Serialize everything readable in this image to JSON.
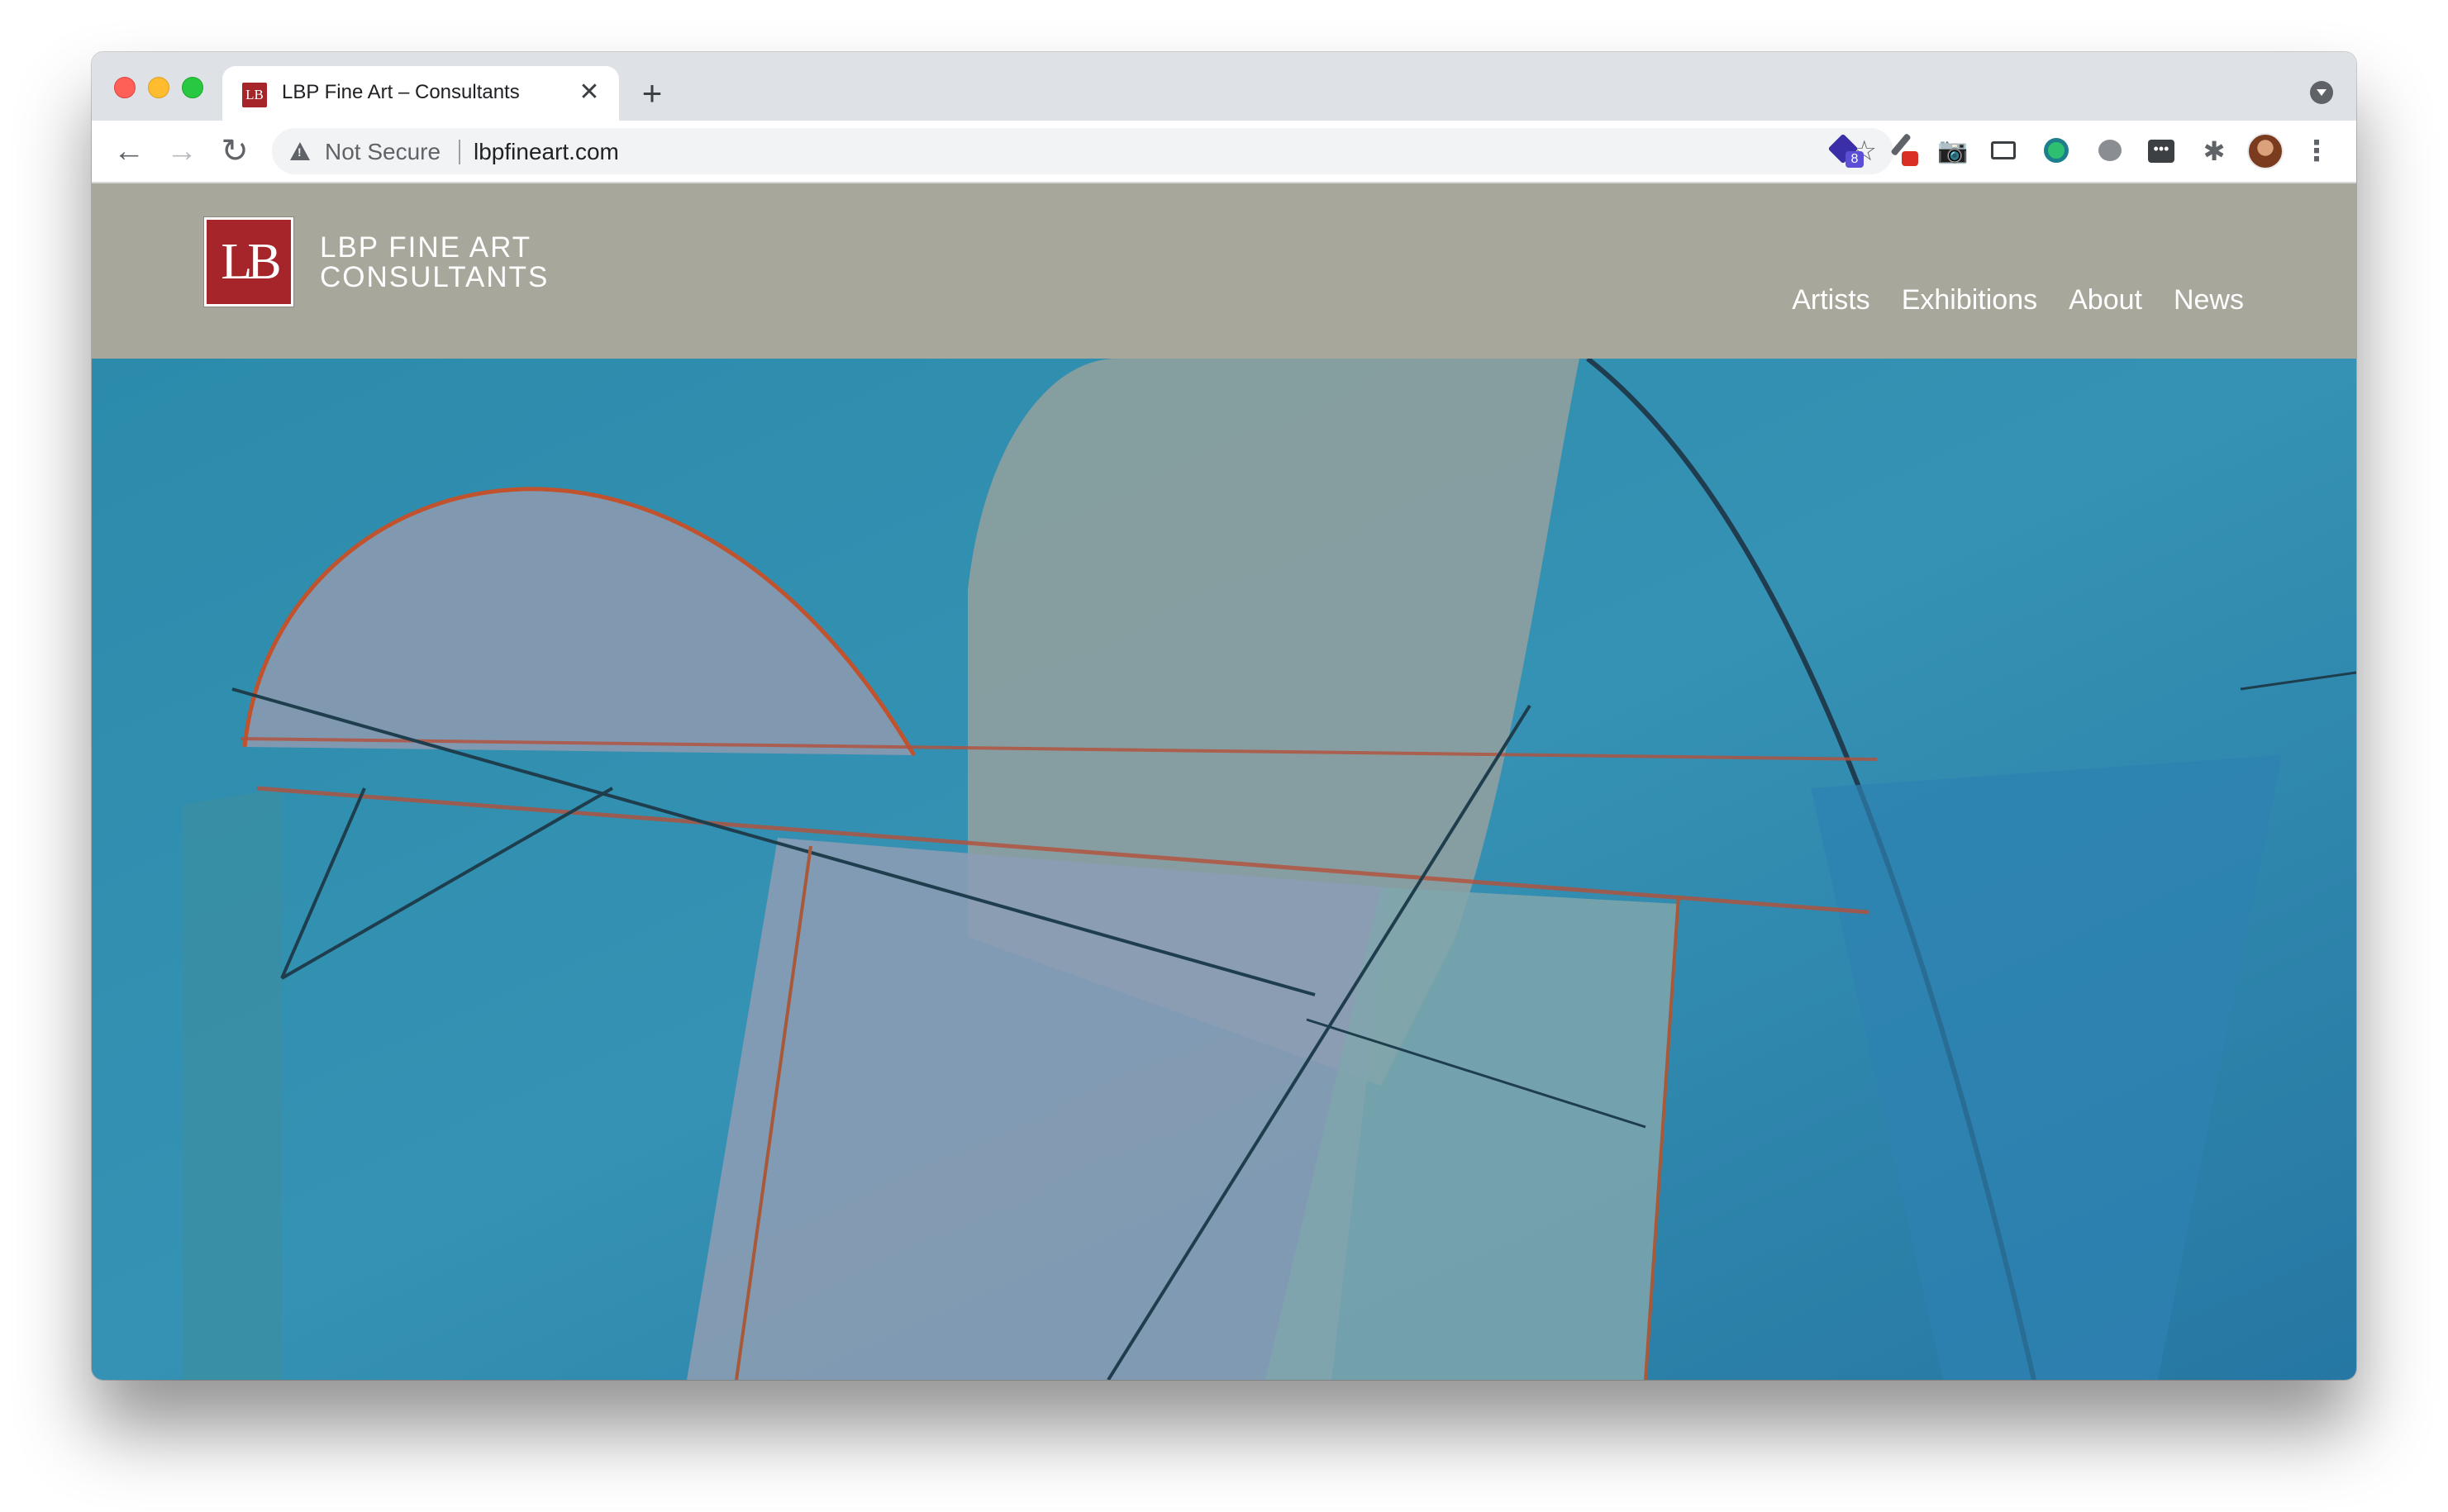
{
  "browser": {
    "tab": {
      "favicon_text": "LB",
      "title": "LBP Fine Art – Consultants",
      "close_glyph": "✕"
    },
    "new_tab_glyph": "+",
    "toolbar": {
      "back_glyph": "←",
      "forward_glyph": "→",
      "reload_glyph": "↻",
      "security_label": "Not Secure",
      "url": "lbpfineart.com",
      "bookmark_glyph": "☆",
      "extensions": [
        {
          "name": "extension-1-icon",
          "badge": "8"
        },
        {
          "name": "eyedropper-extension-icon"
        },
        {
          "name": "camera-extension-icon",
          "glyph": "📷"
        },
        {
          "name": "screen-extension-icon"
        },
        {
          "name": "globe-extension-icon"
        },
        {
          "name": "speech-bubble-extension-icon"
        },
        {
          "name": "password-extension-icon",
          "glyph": "•••"
        },
        {
          "name": "puzzle-extensions-icon",
          "glyph": "✱"
        }
      ],
      "menu_glyph": "⋮"
    }
  },
  "site": {
    "logo_mark": "LB",
    "logo_line1": "LBP FINE ART",
    "logo_line2": "CONSULTANTS",
    "nav": [
      "Artists",
      "Exhibitions",
      "About",
      "News"
    ]
  },
  "colors": {
    "header_bg": "#a7a79b",
    "logo_red": "#a6252a",
    "hero_blue": "#2f86a8"
  }
}
